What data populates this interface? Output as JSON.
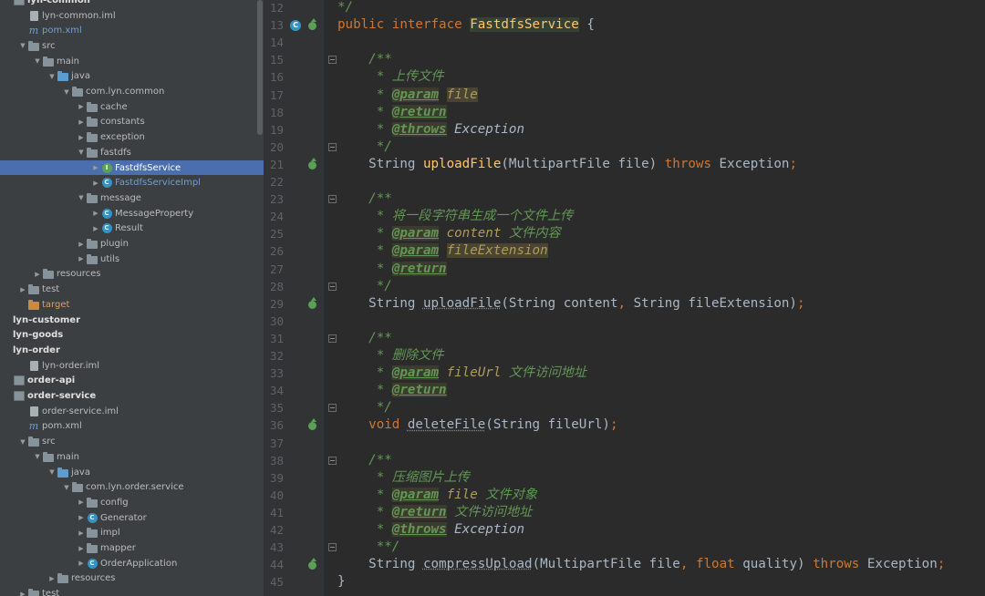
{
  "project_tree": {
    "rows": [
      {
        "label": "lyn-common",
        "indent": 0,
        "arrow": "",
        "icon": "module",
        "style": "bold"
      },
      {
        "label": "lyn-common.iml",
        "indent": 1,
        "arrow": "",
        "icon": "file",
        "style": ""
      },
      {
        "label": "pom.xml",
        "indent": 1,
        "arrow": "",
        "icon": "maven",
        "style": "blue"
      },
      {
        "label": "src",
        "indent": 1,
        "arrow": "▼",
        "icon": "folder",
        "style": ""
      },
      {
        "label": "main",
        "indent": 2,
        "arrow": "▼",
        "icon": "folder",
        "style": ""
      },
      {
        "label": "java",
        "indent": 3,
        "arrow": "▼",
        "icon": "src-folder",
        "style": ""
      },
      {
        "label": "com.lyn.common",
        "indent": 4,
        "arrow": "▼",
        "icon": "folder",
        "style": ""
      },
      {
        "label": "cache",
        "indent": 5,
        "arrow": "▶",
        "icon": "folder",
        "style": ""
      },
      {
        "label": "constants",
        "indent": 5,
        "arrow": "▶",
        "icon": "folder",
        "style": ""
      },
      {
        "label": "exception",
        "indent": 5,
        "arrow": "▶",
        "icon": "folder",
        "style": ""
      },
      {
        "label": "fastdfs",
        "indent": 5,
        "arrow": "▼",
        "icon": "folder",
        "style": ""
      },
      {
        "label": "FastdfsService",
        "indent": 6,
        "arrow": "▶",
        "icon": "interface",
        "style": "sel blue"
      },
      {
        "label": "FastdfsServiceImpl",
        "indent": 6,
        "arrow": "▶",
        "icon": "class",
        "style": "blue"
      },
      {
        "label": "message",
        "indent": 5,
        "arrow": "▼",
        "icon": "folder",
        "style": ""
      },
      {
        "label": "MessageProperty",
        "indent": 6,
        "arrow": "▶",
        "icon": "class",
        "style": ""
      },
      {
        "label": "Result",
        "indent": 6,
        "arrow": "▶",
        "icon": "class",
        "style": ""
      },
      {
        "label": "plugin",
        "indent": 5,
        "arrow": "▶",
        "icon": "folder",
        "style": ""
      },
      {
        "label": "utils",
        "indent": 5,
        "arrow": "▶",
        "icon": "folder",
        "style": ""
      },
      {
        "label": "resources",
        "indent": 2,
        "arrow": "▶",
        "icon": "folder",
        "style": ""
      },
      {
        "label": "test",
        "indent": 1,
        "arrow": "▶",
        "icon": "folder",
        "style": ""
      },
      {
        "label": "target",
        "indent": 1,
        "arrow": "",
        "icon": "orange-folder",
        "style": "orange"
      },
      {
        "label": "lyn-customer",
        "indent": 0,
        "arrow": "",
        "icon": "none",
        "style": "bold"
      },
      {
        "label": "lyn-goods",
        "indent": 0,
        "arrow": "",
        "icon": "none",
        "style": "bold"
      },
      {
        "label": "lyn-order",
        "indent": 0,
        "arrow": "",
        "icon": "none",
        "style": "bold"
      },
      {
        "label": "lyn-order.iml",
        "indent": 1,
        "arrow": "",
        "icon": "file",
        "style": ""
      },
      {
        "label": "order-api",
        "indent": 0,
        "arrow": "",
        "icon": "module",
        "style": "bold"
      },
      {
        "label": "order-service",
        "indent": 0,
        "arrow": "",
        "icon": "module",
        "style": "bold"
      },
      {
        "label": "order-service.iml",
        "indent": 1,
        "arrow": "",
        "icon": "file",
        "style": ""
      },
      {
        "label": "pom.xml",
        "indent": 1,
        "arrow": "",
        "icon": "maven",
        "style": ""
      },
      {
        "label": "src",
        "indent": 1,
        "arrow": "▼",
        "icon": "folder",
        "style": ""
      },
      {
        "label": "main",
        "indent": 2,
        "arrow": "▼",
        "icon": "folder",
        "style": ""
      },
      {
        "label": "java",
        "indent": 3,
        "arrow": "▼",
        "icon": "src-folder",
        "style": ""
      },
      {
        "label": "com.lyn.order.service",
        "indent": 4,
        "arrow": "▼",
        "icon": "folder",
        "style": ""
      },
      {
        "label": "config",
        "indent": 5,
        "arrow": "▶",
        "icon": "folder",
        "style": ""
      },
      {
        "label": "Generator",
        "indent": 5,
        "arrow": "▶",
        "icon": "class",
        "style": ""
      },
      {
        "label": "impl",
        "indent": 5,
        "arrow": "▶",
        "icon": "folder",
        "style": ""
      },
      {
        "label": "mapper",
        "indent": 5,
        "arrow": "▶",
        "icon": "folder",
        "style": ""
      },
      {
        "label": "OrderApplication",
        "indent": 5,
        "arrow": "▶",
        "icon": "class",
        "style": ""
      },
      {
        "label": "resources",
        "indent": 3,
        "arrow": "▶",
        "icon": "folder",
        "style": ""
      },
      {
        "label": "test",
        "indent": 1,
        "arrow": "▶",
        "icon": "folder",
        "style": ""
      }
    ]
  },
  "editor": {
    "line_numbers": [
      "12",
      "13",
      "14",
      "15",
      "16",
      "17",
      "18",
      "19",
      "20",
      "21",
      "22",
      "23",
      "24",
      "25",
      "26",
      "27",
      "28",
      "29",
      "30",
      "31",
      "32",
      "33",
      "34",
      "35",
      "36",
      "37",
      "38",
      "39",
      "40",
      "41",
      "42",
      "43",
      "44",
      "45"
    ],
    "lines": [
      [
        [
          "doc",
          "*/"
        ]
      ],
      [
        [
          "kw",
          "public interface "
        ],
        [
          "cls",
          "FastdfsService"
        ],
        [
          "p",
          " {"
        ]
      ],
      [],
      [
        [
          "doc",
          "    /**"
        ]
      ],
      [
        [
          "doc",
          "     * 上传文件"
        ]
      ],
      [
        [
          "doc",
          "     * "
        ],
        [
          "tag",
          "@param"
        ],
        [
          "doc",
          " "
        ],
        [
          "pnamehl",
          "file"
        ]
      ],
      [
        [
          "doc",
          "     * "
        ],
        [
          "tag",
          "@return"
        ]
      ],
      [
        [
          "doc",
          "     * "
        ],
        [
          "tag",
          "@throws"
        ],
        [
          "doc",
          " "
        ],
        [
          "it",
          "Exception"
        ]
      ],
      [
        [
          "doc",
          "     */"
        ]
      ],
      [
        [
          "p",
          "    String "
        ],
        [
          "meth",
          "uploadFile"
        ],
        [
          "p",
          "(MultipartFile file) "
        ],
        [
          "kw",
          "throws"
        ],
        [
          "p",
          " Exception"
        ],
        [
          "kw",
          ";"
        ]
      ],
      [],
      [
        [
          "doc",
          "    /**"
        ]
      ],
      [
        [
          "doc",
          "     * 将一段字符串生成一个文件上传"
        ]
      ],
      [
        [
          "doc",
          "     * "
        ],
        [
          "tag",
          "@param"
        ],
        [
          "doc",
          " "
        ],
        [
          "pname",
          "content"
        ],
        [
          "doc",
          " 文件内容"
        ]
      ],
      [
        [
          "doc",
          "     * "
        ],
        [
          "tag",
          "@param"
        ],
        [
          "doc",
          " "
        ],
        [
          "pnamehl",
          "fileExtension"
        ]
      ],
      [
        [
          "doc",
          "     * "
        ],
        [
          "tag",
          "@return"
        ]
      ],
      [
        [
          "doc",
          "     */"
        ]
      ],
      [
        [
          "p",
          "    String "
        ],
        [
          "unused",
          "uploadFile"
        ],
        [
          "p",
          "(String content"
        ],
        [
          "kw",
          ","
        ],
        [
          "p",
          " String fileExtension)"
        ],
        [
          "kw",
          ";"
        ]
      ],
      [],
      [
        [
          "doc",
          "    /**"
        ]
      ],
      [
        [
          "doc",
          "     * 删除文件"
        ]
      ],
      [
        [
          "doc",
          "     * "
        ],
        [
          "tag",
          "@param"
        ],
        [
          "doc",
          " "
        ],
        [
          "pname",
          "fileUrl"
        ],
        [
          "doc",
          " 文件访问地址"
        ]
      ],
      [
        [
          "doc",
          "     * "
        ],
        [
          "tag",
          "@return"
        ]
      ],
      [
        [
          "doc",
          "     */"
        ]
      ],
      [
        [
          "kw",
          "    void "
        ],
        [
          "unused",
          "deleteFile"
        ],
        [
          "p",
          "(String fileUrl)"
        ],
        [
          "kw",
          ";"
        ]
      ],
      [],
      [
        [
          "doc",
          "    /**"
        ]
      ],
      [
        [
          "doc",
          "     * 压缩图片上传"
        ]
      ],
      [
        [
          "doc",
          "     * "
        ],
        [
          "tag",
          "@param"
        ],
        [
          "doc",
          " "
        ],
        [
          "pname",
          "file"
        ],
        [
          "doc",
          " 文件对象"
        ]
      ],
      [
        [
          "doc",
          "     * "
        ],
        [
          "tag",
          "@return"
        ],
        [
          "doc",
          " 文件访问地址"
        ]
      ],
      [
        [
          "doc",
          "     * "
        ],
        [
          "tag",
          "@throws"
        ],
        [
          "doc",
          " "
        ],
        [
          "it",
          "Exception"
        ]
      ],
      [
        [
          "doc",
          "     **/"
        ]
      ],
      [
        [
          "p",
          "    String "
        ],
        [
          "unused",
          "compressUpload"
        ],
        [
          "p",
          "(MultipartFile file"
        ],
        [
          "kw",
          ","
        ],
        [
          "kw",
          " float"
        ],
        [
          "p",
          " quality) "
        ],
        [
          "kw",
          "throws"
        ],
        [
          "p",
          " Exception"
        ],
        [
          "kw",
          ";"
        ]
      ],
      [
        [
          "p",
          "}"
        ]
      ]
    ],
    "impl_marker_lines": [
      21,
      29,
      36,
      44
    ],
    "fold_marker_lines": [
      15,
      20,
      23,
      28,
      31,
      35,
      38,
      43
    ]
  }
}
